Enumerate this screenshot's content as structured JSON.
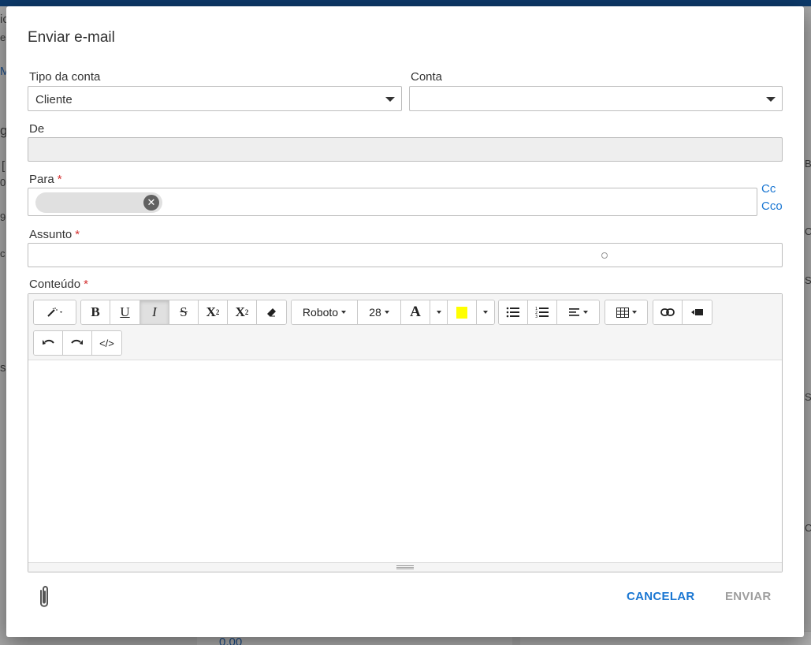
{
  "background": {
    "fragments": [
      "ic",
      "es",
      "M",
      "g",
      "[",
      "0",
      "9",
      "c",
      "s",
      "B",
      "C",
      "S",
      "S",
      "C"
    ],
    "money": "0,00"
  },
  "dialog": {
    "title": "Enviar e-mail",
    "tipo_conta": {
      "label": "Tipo da conta",
      "value": "Cliente"
    },
    "conta": {
      "label": "Conta",
      "value": ""
    },
    "de": {
      "label": "De",
      "value": ""
    },
    "para": {
      "label": "Para",
      "required": "*",
      "chip_text": "",
      "cc": "Cc",
      "cco": "Cco"
    },
    "assunto": {
      "label": "Assunto",
      "required": "*",
      "value": ""
    },
    "conteudo": {
      "label": "Conteúdo",
      "required": "*"
    },
    "toolbar": {
      "bold": "B",
      "underline": "U",
      "italic": "I",
      "strikethrough": "S",
      "superscript": "X",
      "subscript": "X",
      "font_name": "Roboto",
      "font_size": "28",
      "font_color": "A",
      "highlight_color": "#ffff00",
      "code_view": "</>",
      "italic_active": true
    },
    "footer": {
      "cancel": "CANCELAR",
      "send": "ENVIAR"
    }
  },
  "colors": {
    "accent": "#1976d2",
    "required": "#d32f2f",
    "disabled_text": "#9e9e9e"
  }
}
